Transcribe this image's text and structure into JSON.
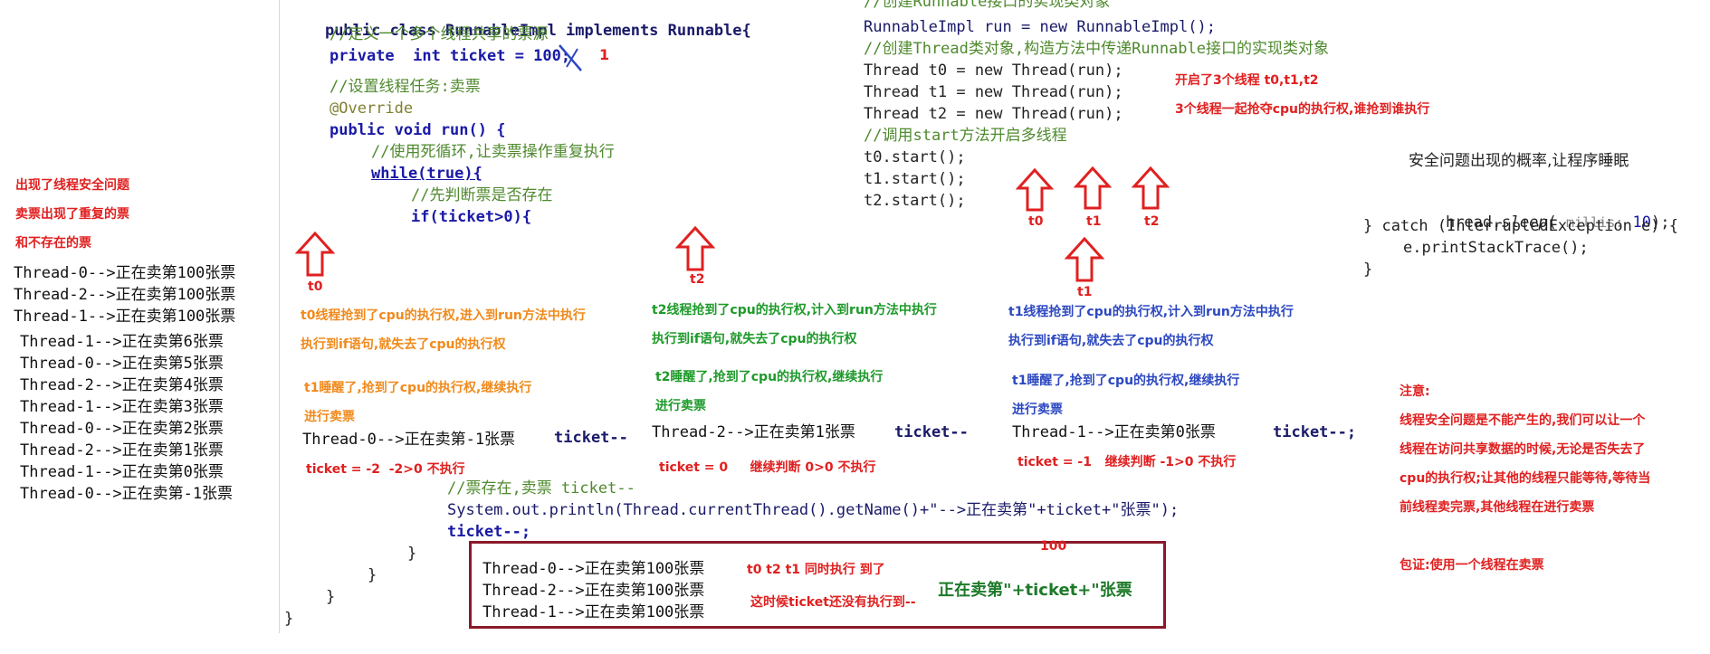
{
  "left_panel": {
    "issue_lines": [
      "出现了线程安全问题",
      "卖票出现了重复的票",
      "和不存在的票"
    ],
    "output_lines_a": [
      "Thread-0-->正在卖第100张票",
      "Thread-2-->正在卖第100张票",
      "Thread-1-->正在卖第100张票"
    ],
    "output_lines_b": [
      "Thread-1-->正在卖第6张票",
      "Thread-0-->正在卖第5张票",
      "Thread-2-->正在卖第4张票",
      "Thread-1-->正在卖第3张票",
      "Thread-0-->正在卖第2张票",
      "Thread-2-->正在卖第1张票",
      "Thread-1-->正在卖第0张票",
      "Thread-0-->正在卖第-1张票"
    ]
  },
  "runnable_code": {
    "class_line": "public class RunnableImpl implements Runnable{",
    "comment_ticket": "//定义一个多个线程共享的票源",
    "field_line": "private  int ticket = 100;",
    "note_1": "1",
    "comment_task": "//设置线程任务:卖票",
    "override": "@Override",
    "run_line": "public void run() {",
    "comment_loop": "//使用死循环,让卖票操作重复执行",
    "while_line": "while(true){",
    "comment_check": "//先判断票是否存在",
    "if_line": "if(ticket>0){",
    "comment_sell": "//票存在,卖票 ticket--",
    "println_line": "System.out.println(Thread.currentThread().getName()+\"-->正在卖第\"+ticket+\"张票\");",
    "decrement_line": "ticket--;",
    "close_1": "}",
    "close_2": "}",
    "close_3": "}",
    "close_4": "}"
  },
  "main_code": {
    "comment_impl": "//创建Runnable接口的实现类对象",
    "impl_line": "RunnableImpl run = new RunnableImpl();",
    "comment_thread": "//创建Thread类对象,构造方法中传递Runnable接口的实现类对象",
    "t0_line": "Thread t0 = new Thread(run);",
    "t1_line": "Thread t1 = new Thread(run);",
    "t2_line": "Thread t2 = new Thread(run);",
    "comment_start": "//调用start方法开启多线程",
    "start0": "t0.start();",
    "start1": "t1.start();",
    "start2": "t2.start();",
    "note_open": "开启了3个线程 t0,t1,t2",
    "note_compete": "3个线程一起抢夺cpu的执行权,谁抢到谁执行",
    "arrow_labels": [
      "t0",
      "t1",
      "t2"
    ]
  },
  "sleep_code": {
    "comment": "安全问题出现的概率,让程序睡眠",
    "sleep_line_prefix": "hread.",
    "sleep_method": "sleep",
    "sleep_hint": "millis:",
    "sleep_value": "10",
    "sleep_suffix": ");",
    "catch_line": "} catch (InterruptedException e) {",
    "print_trace": "e.printStackTrace();",
    "close": "}"
  },
  "t0_column": {
    "label": "t0",
    "note1": "t0线程抢到了cpu的执行权,进入到run方法中执行",
    "note2": "执行到if语句,就失去了cpu的执行权",
    "note3": "t1睡醒了,抢到了cpu的执行权,继续执行",
    "note4": "进行卖票",
    "output": "Thread-0-->正在卖第-1张票",
    "decrement": "ticket--",
    "result": "ticket = -2  -2>0 不执行"
  },
  "t2_column": {
    "label": "t2",
    "note1": "t2线程抢到了cpu的执行权,计入到run方法中执行",
    "note2": "执行到if语句,就失去了cpu的执行权",
    "note3": "t2睡醒了,抢到了cpu的执行权,继续执行",
    "note4": "进行卖票",
    "output": "Thread-2-->正在卖第1张票",
    "decrement": "ticket--",
    "result": "ticket = 0     继续判断 0>0 不执行"
  },
  "t1_column": {
    "label": "t1",
    "note1": "t1线程抢到了cpu的执行权,计入到run方法中执行",
    "note2": "执行到if语句,就失去了cpu的执行权",
    "note3": "t1睡醒了,抢到了cpu的执行权,继续执行",
    "note4": "进行卖票",
    "output": "Thread-1-->正在卖第0张票",
    "decrement": "ticket--;",
    "result": "ticket = -1   继续判断 -1>0 不执行"
  },
  "output_box": {
    "lines": [
      "Thread-0-->正在卖第100张票",
      "Thread-2-->正在卖第100张票",
      "Thread-1-->正在卖第100张票"
    ],
    "note_same": "t0 t2 t1 同时执行 到了",
    "note_expr": "正在卖第\"+ticket+\"张票",
    "note_100": "100",
    "note_not_yet": "这时候ticket还没有执行到--"
  },
  "notice": {
    "title": "注意:",
    "lines": [
      "线程安全问题是不能产生的,我们可以让一个",
      "线程在访问共享数据的时候,无论是否失去了",
      "cpu的执行权;让其他的线程只能等待,等待当",
      "前线程卖完票,其他线程在进行卖票"
    ],
    "guarantee": "包证:使用一个线程在卖票"
  },
  "colors": {
    "red": "#e02020",
    "orange": "#f08a1c",
    "green": "#1e9a2a",
    "blue": "#2c48c0",
    "box_border": "#8a1a2a"
  }
}
